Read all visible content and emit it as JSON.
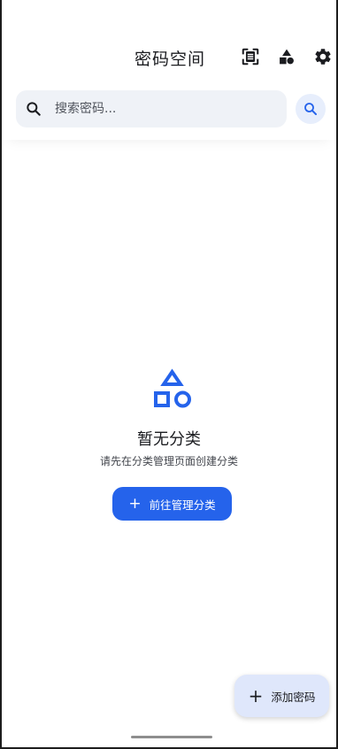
{
  "app_bar": {
    "title": "密码空间",
    "actions": [
      {
        "icon": "scan-icon"
      },
      {
        "icon": "category-icon"
      },
      {
        "icon": "settings-icon"
      }
    ]
  },
  "search": {
    "placeholder": "搜索密码...",
    "value": ""
  },
  "empty_state": {
    "icon": "category-icon",
    "title": "暂无分类",
    "subtitle": "请先在分类管理页面创建分类",
    "button_label": "前往管理分类"
  },
  "fab": {
    "label": "添加密码"
  },
  "colors": {
    "accent": "#2563eb",
    "search_bg": "#eff2f7",
    "fab_bg": "#dfe7fb"
  }
}
